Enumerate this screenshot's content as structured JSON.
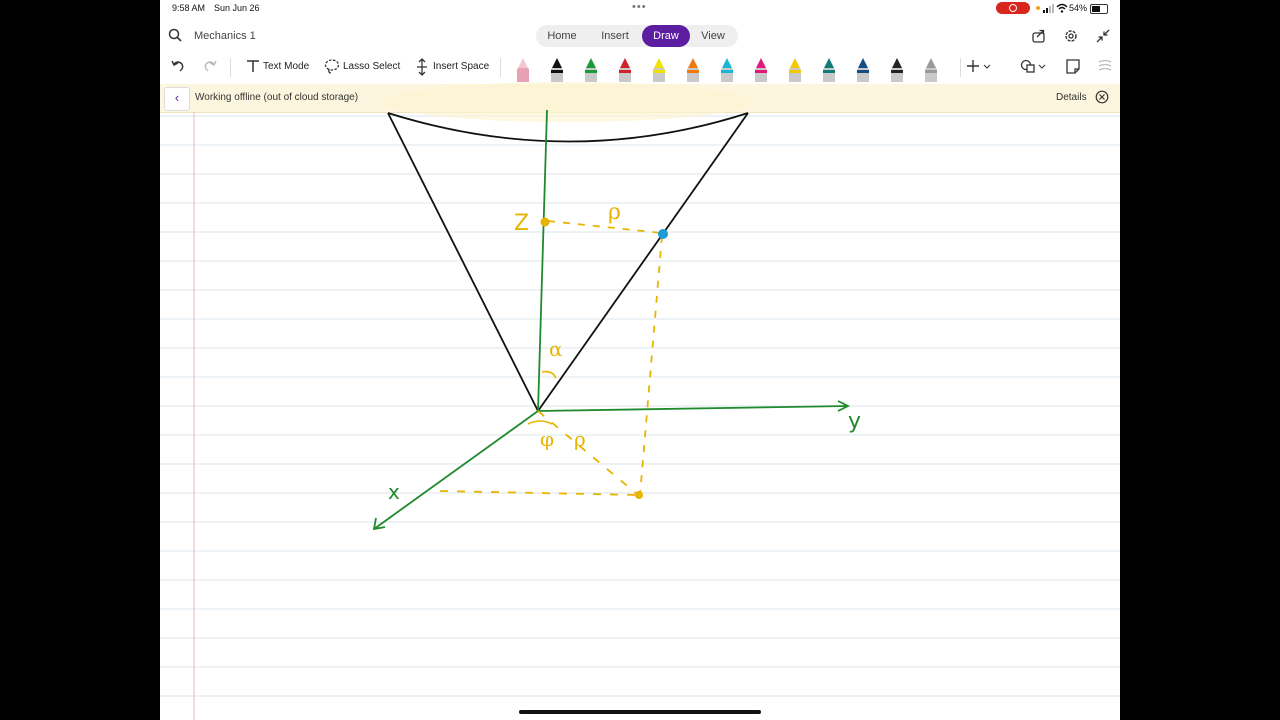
{
  "status_bar": {
    "time": "9:58 AM",
    "date": "Sun Jun 26",
    "battery_pct": "54%",
    "battery_level": 0.54
  },
  "header": {
    "doc_title": "Mechanics 1",
    "tabs": [
      {
        "label": "Home",
        "active": false
      },
      {
        "label": "Insert",
        "active": false
      },
      {
        "label": "Draw",
        "active": true
      },
      {
        "label": "View",
        "active": false
      }
    ],
    "icons": [
      "search-icon",
      "share-icon",
      "settings-icon",
      "collapse-icon"
    ],
    "accent_color": "#5b1ea0"
  },
  "toolbar": {
    "text_mode": "Text Mode",
    "lasso_select": "Lasso Select",
    "insert_space": "Insert Space",
    "pens": [
      {
        "name": "eraser",
        "color": "#e8a0b4"
      },
      {
        "name": "pen-black",
        "color": "#111111"
      },
      {
        "name": "pen-green",
        "color": "#1a9a3a"
      },
      {
        "name": "pen-red",
        "color": "#d0202a"
      },
      {
        "name": "highlighter-yellow",
        "color": "#f2e200"
      },
      {
        "name": "pen-orange",
        "color": "#f07a10"
      },
      {
        "name": "pen-cyan",
        "color": "#19b5d6"
      },
      {
        "name": "pen-magenta",
        "color": "#e0197a"
      },
      {
        "name": "highlighter-gold",
        "color": "#f5c800"
      },
      {
        "name": "pen-teal",
        "color": "#137a7a"
      },
      {
        "name": "pen-navy",
        "color": "#124d8a"
      },
      {
        "name": "pen-black-2",
        "color": "#222222"
      },
      {
        "name": "pen-gray",
        "color": "#9a9a9a"
      }
    ]
  },
  "banner": {
    "message": "Working offline (out of cloud storage)",
    "details_label": "Details"
  },
  "drawing": {
    "labels": {
      "z": "Z",
      "y": "y",
      "x": "x",
      "alpha": "α",
      "phi": "φ",
      "rho_top": "ρ",
      "rho_bottom": "ρ"
    },
    "colors": {
      "axes": "#1f8a2c",
      "cone": "#111111",
      "projection": "#e8b400",
      "point": "#1e9bd6"
    }
  }
}
